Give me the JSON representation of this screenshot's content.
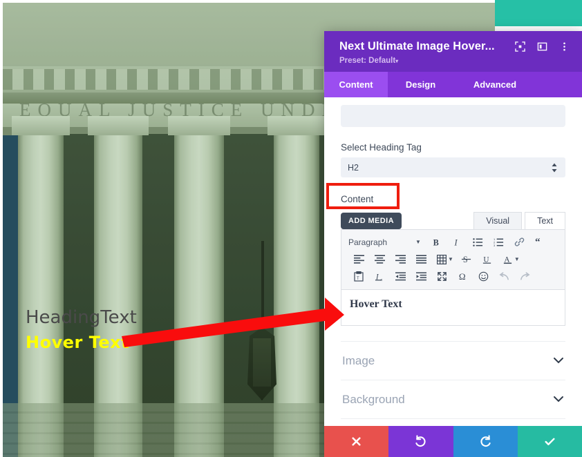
{
  "image_overlay": {
    "heading_text": "HeadingText",
    "hover_text": "Hover Text",
    "inscription": "EQUAL JUSTICE UNDER LAW"
  },
  "panel": {
    "title": "Next Ultimate Image Hover...",
    "preset_label": "Preset: Default",
    "preset_caret": "▾",
    "header_icons": [
      {
        "name": "focus-target-icon"
      },
      {
        "name": "layout-panel-icon"
      },
      {
        "name": "overflow-menu-icon"
      }
    ],
    "tabs": [
      {
        "label": "Content",
        "active": true
      },
      {
        "label": "Design",
        "active": false
      },
      {
        "label": "Advanced",
        "active": false
      }
    ],
    "fields": {
      "blank_input_value": "",
      "heading_tag_label": "Select Heading Tag",
      "heading_tag_value": "H2",
      "content_label": "Content"
    },
    "editor": {
      "add_media_label": "ADD MEDIA",
      "mode_tabs": [
        {
          "label": "Visual",
          "active": true
        },
        {
          "label": "Text",
          "active": false
        }
      ],
      "format_select": "Paragraph",
      "body_text": "Hover Text",
      "toolbar_row1": [
        "bold-icon",
        "italic-icon",
        "bulleted-list-icon",
        "numbered-list-icon",
        "link-icon",
        "blockquote-icon"
      ],
      "toolbar_row2": [
        "align-left-icon",
        "align-center-icon",
        "align-right-icon",
        "align-justify-icon",
        "table-icon",
        "strikethrough-icon",
        "underline-icon",
        "text-color-icon"
      ],
      "toolbar_row3": [
        "paste-as-text-icon",
        "clear-formatting-icon",
        "outdent-icon",
        "indent-icon",
        "fullscreen-icon",
        "special-character-icon",
        "emoji-icon",
        "undo-icon",
        "redo-icon"
      ]
    },
    "accordions": [
      {
        "label": "Image",
        "icon": "chevron-down-icon"
      },
      {
        "label": "Background",
        "icon": "chevron-down-icon"
      }
    ],
    "actions": [
      {
        "name": "close-button",
        "icon": "x-icon",
        "color": "#e8514d"
      },
      {
        "name": "undo-button",
        "icon": "undo-arrow-icon",
        "color": "#7b35d6"
      },
      {
        "name": "redo-button",
        "icon": "redo-arrow-icon",
        "color": "#2a8ed6"
      },
      {
        "name": "save-button",
        "icon": "check-icon",
        "color": "#26bba2"
      }
    ]
  },
  "colors": {
    "header_purple": "#6b2cbf",
    "tab_bar_purple": "#8134d8",
    "active_tab_purple": "#9b4ef0",
    "teal": "#26c0a6",
    "annotation_red": "#ef1d0e",
    "hover_text_yellow": "#ffff00"
  }
}
